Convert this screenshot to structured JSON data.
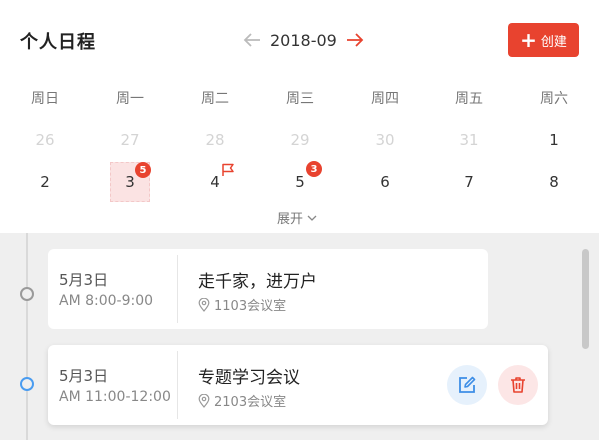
{
  "header": {
    "title": "个人日程",
    "month": "2018-09",
    "create_label": "创建"
  },
  "colors": {
    "accent": "#e8432f",
    "blue": "#4a9cf0",
    "muted": "#d4d4d4"
  },
  "weekdays": [
    "周日",
    "周一",
    "周二",
    "周三",
    "周四",
    "周五",
    "周六"
  ],
  "week1": [
    "26",
    "27",
    "28",
    "29",
    "30",
    "31",
    "1"
  ],
  "week2": [
    "2",
    "3",
    "4",
    "5",
    "6",
    "7",
    "8"
  ],
  "badges": {
    "mon": "5",
    "wed": "3"
  },
  "expand_label": "展开",
  "events": [
    {
      "date": "5月3日",
      "time": "AM 8:00-9:00",
      "title": "走千家，进万户",
      "location": "1103会议室"
    },
    {
      "date": "5月3日",
      "time": "AM 11:00-12:00",
      "title": "专题学习会议",
      "location": "2103会议室"
    }
  ]
}
